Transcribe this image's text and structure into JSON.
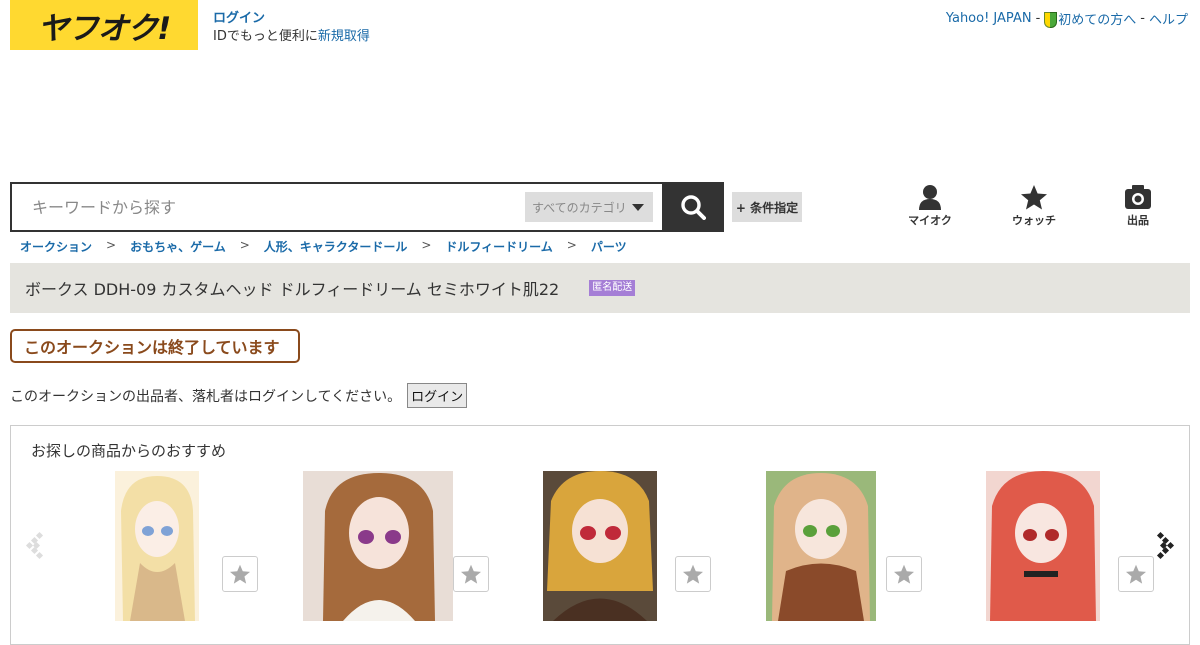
{
  "logo": {
    "text": "ヤフオク!"
  },
  "login": {
    "login_label": "ログイン",
    "prefix": "IDでもっと便利に",
    "signup_label": "新規取得"
  },
  "top_links": {
    "yahoo": "Yahoo! JAPAN",
    "beginner": "初めての方へ",
    "help": "ヘルプ",
    "separator": "-"
  },
  "search": {
    "placeholder": "キーワードから探す",
    "category": "すべてのカテゴリ",
    "condition_label": "+ 条件指定"
  },
  "header_icons": {
    "myauc": "マイオク",
    "watch": "ウォッチ",
    "sell": "出品"
  },
  "breadcrumb": [
    "オークション",
    "おもちゃ、ゲーム",
    "人形、キャラクタードール",
    "ドルフィードリーム",
    "パーツ"
  ],
  "breadcrumb_sep": ">",
  "item": {
    "title": "ボークス DDH-09 カスタムヘッド ドルフィードリーム セミホワイト肌22",
    "badge": "匿名配送"
  },
  "status": {
    "ended": "このオークションは終了しています"
  },
  "login_note": {
    "text": "このオークションの出品者、落札者はログインしてください。",
    "button": "ログイン"
  },
  "recommend": {
    "heading": "お探しの商品からのおすすめ",
    "items": [
      {
        "icon": "star-icon",
        "hair": "#f3dfa6",
        "bg": "#fbf1dc"
      },
      {
        "icon": "star-icon",
        "hair": "#a56a3c",
        "bg": "#e8ddd6"
      },
      {
        "icon": "star-icon",
        "hair": "#d9a53c",
        "bg": "#5a4a3a"
      },
      {
        "icon": "star-icon",
        "hair": "#e0b48a",
        "bg": "#9ab87a"
      },
      {
        "icon": "star-icon",
        "hair": "#e05a4a",
        "bg": "#f2d6d0"
      }
    ]
  },
  "colors": {
    "brand_yellow": "#ffd930",
    "link": "#1a6aa8",
    "ended": "#8a4a1c",
    "badge": "#a57ed6"
  }
}
